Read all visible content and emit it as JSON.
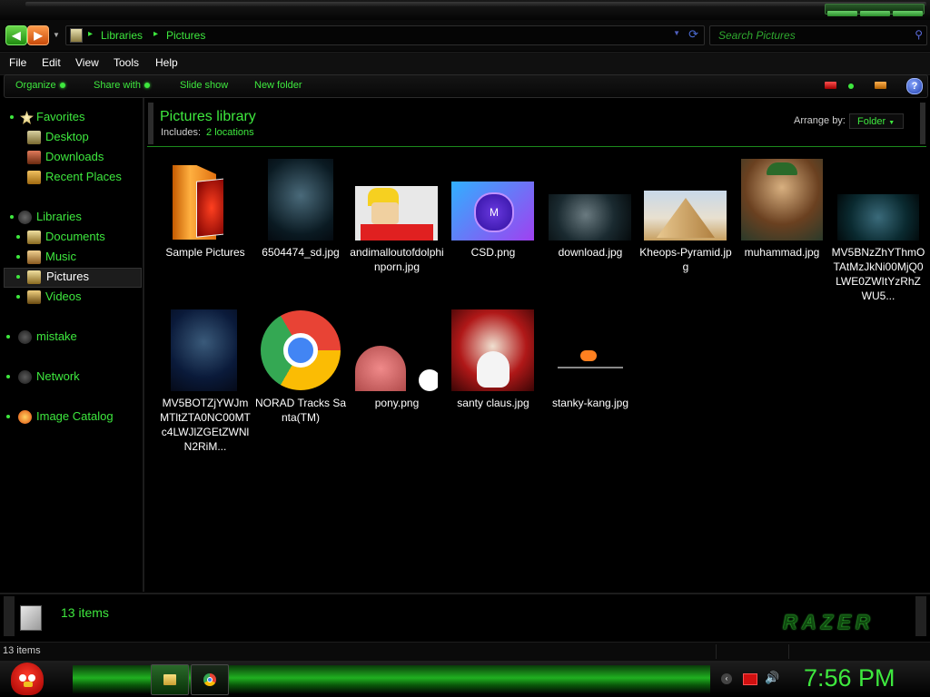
{
  "window": {
    "title": "Pictures"
  },
  "nav": {
    "breadcrumbs": [
      "Libraries",
      "Pictures"
    ],
    "search_placeholder": "Search Pictures"
  },
  "menu": [
    "File",
    "Edit",
    "View",
    "Tools",
    "Help"
  ],
  "toolbar": {
    "organize": "Organize",
    "share_with": "Share with",
    "slide_show": "Slide show",
    "new_folder": "New folder",
    "help_glyph": "?"
  },
  "sidebar": {
    "favorites": {
      "label": "Favorites",
      "items": [
        "Desktop",
        "Downloads",
        "Recent Places"
      ]
    },
    "libraries": {
      "label": "Libraries",
      "items": [
        "Documents",
        "Music",
        "Pictures",
        "Videos"
      ],
      "selected": "Pictures"
    },
    "homegroup": "mistake",
    "network": "Network",
    "image_catalog": "Image Catalog"
  },
  "library": {
    "title": "Pictures library",
    "includes_label": "Includes:",
    "locations": "2 locations",
    "arrange_label": "Arrange by:",
    "arrange_value": "Folder"
  },
  "files": [
    {
      "name": "Sample Pictures",
      "kind": "folder"
    },
    {
      "name": "6504474_sd.jpg",
      "kind": "image"
    },
    {
      "name": "andimalloutofdolphinporn.jpg",
      "kind": "image"
    },
    {
      "name": "CSD.png",
      "kind": "image"
    },
    {
      "name": "download.jpg",
      "kind": "image"
    },
    {
      "name": "Kheops-Pyramid.jpg",
      "kind": "image"
    },
    {
      "name": "muhammad.jpg",
      "kind": "image"
    },
    {
      "name": "MV5BNzZhYThmOTAtMzJkNi00MjQ0LWE0ZWItYzRhZWU5...",
      "kind": "image"
    },
    {
      "name": "MV5BOTZjYWJmMTltZTA0NC00MTc4LWJlZGEtZWNlN2RiM...",
      "kind": "image"
    },
    {
      "name": "NORAD Tracks Santa(TM)",
      "kind": "shortcut"
    },
    {
      "name": "pony.png",
      "kind": "image"
    },
    {
      "name": "santy claus.jpg",
      "kind": "image"
    },
    {
      "name": "stanky-kang.jpg",
      "kind": "image"
    }
  ],
  "thumb_text": {
    "csd_badge": "M"
  },
  "status": {
    "count": "13 items",
    "bottom": "13 items",
    "brand": "RAZER"
  },
  "taskbar": {
    "clock": "7:56 PM"
  },
  "colors": {
    "accent": "#3ee83e",
    "background": "#000000",
    "tray_alert": "#d01010"
  },
  "icons": {
    "back": "back-arrow-icon",
    "forward": "forward-arrow-icon",
    "search": "search-icon",
    "refresh": "refresh-icon",
    "help": "help-icon",
    "start": "angry-bird-start-icon"
  }
}
